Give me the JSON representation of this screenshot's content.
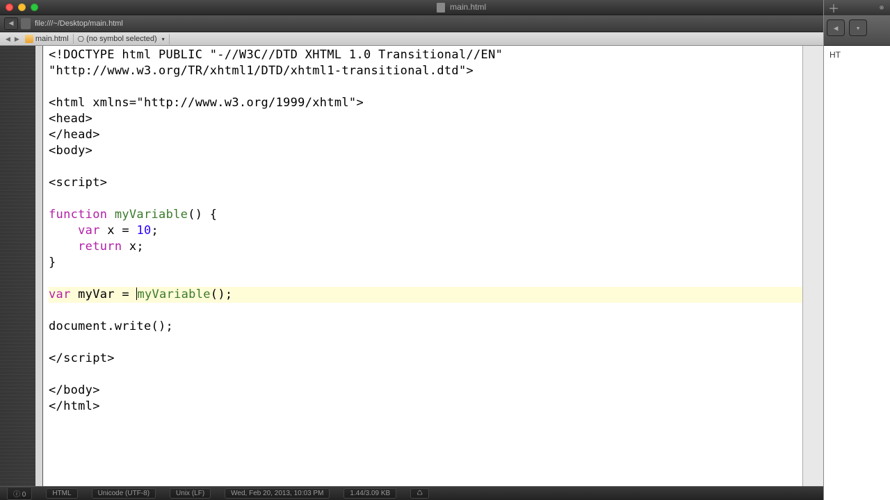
{
  "window": {
    "title": "main.html"
  },
  "path_bar": {
    "path": "file:///~/Desktop/main.html"
  },
  "breadcrumb": {
    "file": "main.html",
    "symbol": "(no symbol selected)"
  },
  "far_right": {
    "label": "HT"
  },
  "status": {
    "seg1": "ⓘ 0",
    "seg2": "HTML",
    "seg3": "Unicode (UTF-8)",
    "seg4": "Unix (LF)",
    "seg5": "Wed, Feb 20, 2013, 10:03 PM",
    "seg6": "1.44/3.09 KB",
    "seg7": "♺"
  },
  "code": {
    "lines": [
      {
        "segments": [
          {
            "t": "<!DOCTYPE html PUBLIC \"-//W3C//DTD XHTML 1.0 Transitional//EN\"",
            "c": "tag"
          }
        ]
      },
      {
        "segments": [
          {
            "t": "\"http://www.w3.org/TR/xhtml1/DTD/xhtml1-transitional.dtd\">",
            "c": "tag"
          }
        ]
      },
      {
        "segments": []
      },
      {
        "segments": [
          {
            "t": "<html xmlns=\"http://www.w3.org/1999/xhtml\">",
            "c": "tag"
          }
        ]
      },
      {
        "segments": [
          {
            "t": "<head>",
            "c": "tag"
          }
        ]
      },
      {
        "segments": [
          {
            "t": "</head>",
            "c": "tag"
          }
        ]
      },
      {
        "segments": [
          {
            "t": "<body>",
            "c": "tag"
          }
        ]
      },
      {
        "segments": []
      },
      {
        "segments": [
          {
            "t": "<script>",
            "c": "tag"
          }
        ]
      },
      {
        "segments": []
      },
      {
        "segments": [
          {
            "t": "function",
            "c": "kw"
          },
          {
            "t": " ",
            "c": ""
          },
          {
            "t": "myVariable",
            "c": "fn"
          },
          {
            "t": "() {",
            "c": ""
          }
        ]
      },
      {
        "segments": [
          {
            "t": "    ",
            "c": ""
          },
          {
            "t": "var",
            "c": "kw"
          },
          {
            "t": " x = ",
            "c": ""
          },
          {
            "t": "10",
            "c": "num"
          },
          {
            "t": ";",
            "c": ""
          }
        ]
      },
      {
        "segments": [
          {
            "t": "    ",
            "c": ""
          },
          {
            "t": "return",
            "c": "kw"
          },
          {
            "t": " x;",
            "c": ""
          }
        ]
      },
      {
        "segments": [
          {
            "t": "}",
            "c": ""
          }
        ]
      },
      {
        "segments": []
      },
      {
        "highlighted": true,
        "cursor_after": 2,
        "segments": [
          {
            "t": "var",
            "c": "kw"
          },
          {
            "t": " myVar = ",
            "c": ""
          },
          {
            "t": "myVariable",
            "c": "fn"
          },
          {
            "t": "();",
            "c": ""
          }
        ]
      },
      {
        "segments": []
      },
      {
        "segments": [
          {
            "t": "document.write();",
            "c": ""
          }
        ]
      },
      {
        "segments": []
      },
      {
        "segments": [
          {
            "t": "</script>",
            "c": "tag"
          }
        ]
      },
      {
        "segments": []
      },
      {
        "segments": [
          {
            "t": "</body>",
            "c": "tag"
          }
        ]
      },
      {
        "segments": [
          {
            "t": "</html>",
            "c": "tag"
          }
        ]
      }
    ]
  }
}
